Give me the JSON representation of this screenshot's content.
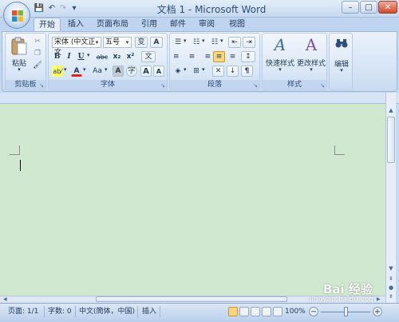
{
  "window": {
    "title": "文档 1 - Microsoft Word",
    "minimize": "–",
    "maximize": "□",
    "close": "✕"
  },
  "quick_access": {
    "save": "💾",
    "undo": "↶",
    "redo": "↷",
    "customize": "▾"
  },
  "tabs": [
    "开始",
    "插入",
    "页面布局",
    "引用",
    "邮件",
    "审阅",
    "视图"
  ],
  "ribbon": {
    "clipboard": {
      "label": "剪贴板",
      "paste": "粘贴",
      "paste_icon": "clipboard-icon",
      "cut": "✂",
      "copy": "❐",
      "format_painter": "🖌"
    },
    "font": {
      "label": "字体",
      "font_name": "宋体 (中文正文",
      "font_size": "五号",
      "bold": "B",
      "italic": "I",
      "underline": "U",
      "strikethrough": "abc",
      "subscript": "x₂",
      "superscript": "x²",
      "grow": "A",
      "shrink": "A",
      "change_case": "Aa",
      "clear_format": "变",
      "highlight": "ab⁄",
      "font_color": "A",
      "char_shading": "A",
      "enclose": "字",
      "phonetic": "文",
      "char_border": "A"
    },
    "paragraph": {
      "label": "段落",
      "bullets": "☰",
      "numbering": "☷",
      "multilevel": "☷",
      "decrease_indent": "⇤",
      "increase_indent": "⇥",
      "align_left": "≡",
      "center": "≡",
      "align_right": "≡",
      "justify": "≡",
      "distributed": "≡",
      "line_spacing": "↕",
      "shading": "◈",
      "borders": "⊞",
      "sort": "↓",
      "show_marks": "¶",
      "chinese_layout": "✕"
    },
    "styles": {
      "label": "样式",
      "quick_styles": "快速样式",
      "change_styles": "更改样式",
      "styles_icon": "A"
    },
    "editing": {
      "label": "编辑",
      "icon": "binoculars-icon"
    }
  },
  "statusbar": {
    "page": "页面: 1/1",
    "words": "字数: 0",
    "language": "中文(簡体，中国)",
    "mode": "插入",
    "zoom": "100%",
    "zoom_out": "−",
    "zoom_in": "+"
  },
  "watermark": {
    "brand": "Bai 经验",
    "url": "jingyan.baidu.com"
  },
  "colors": {
    "doc_background": "#cfe8cf",
    "ribbon": "#d4e3f5",
    "accent": "#1e395b"
  }
}
